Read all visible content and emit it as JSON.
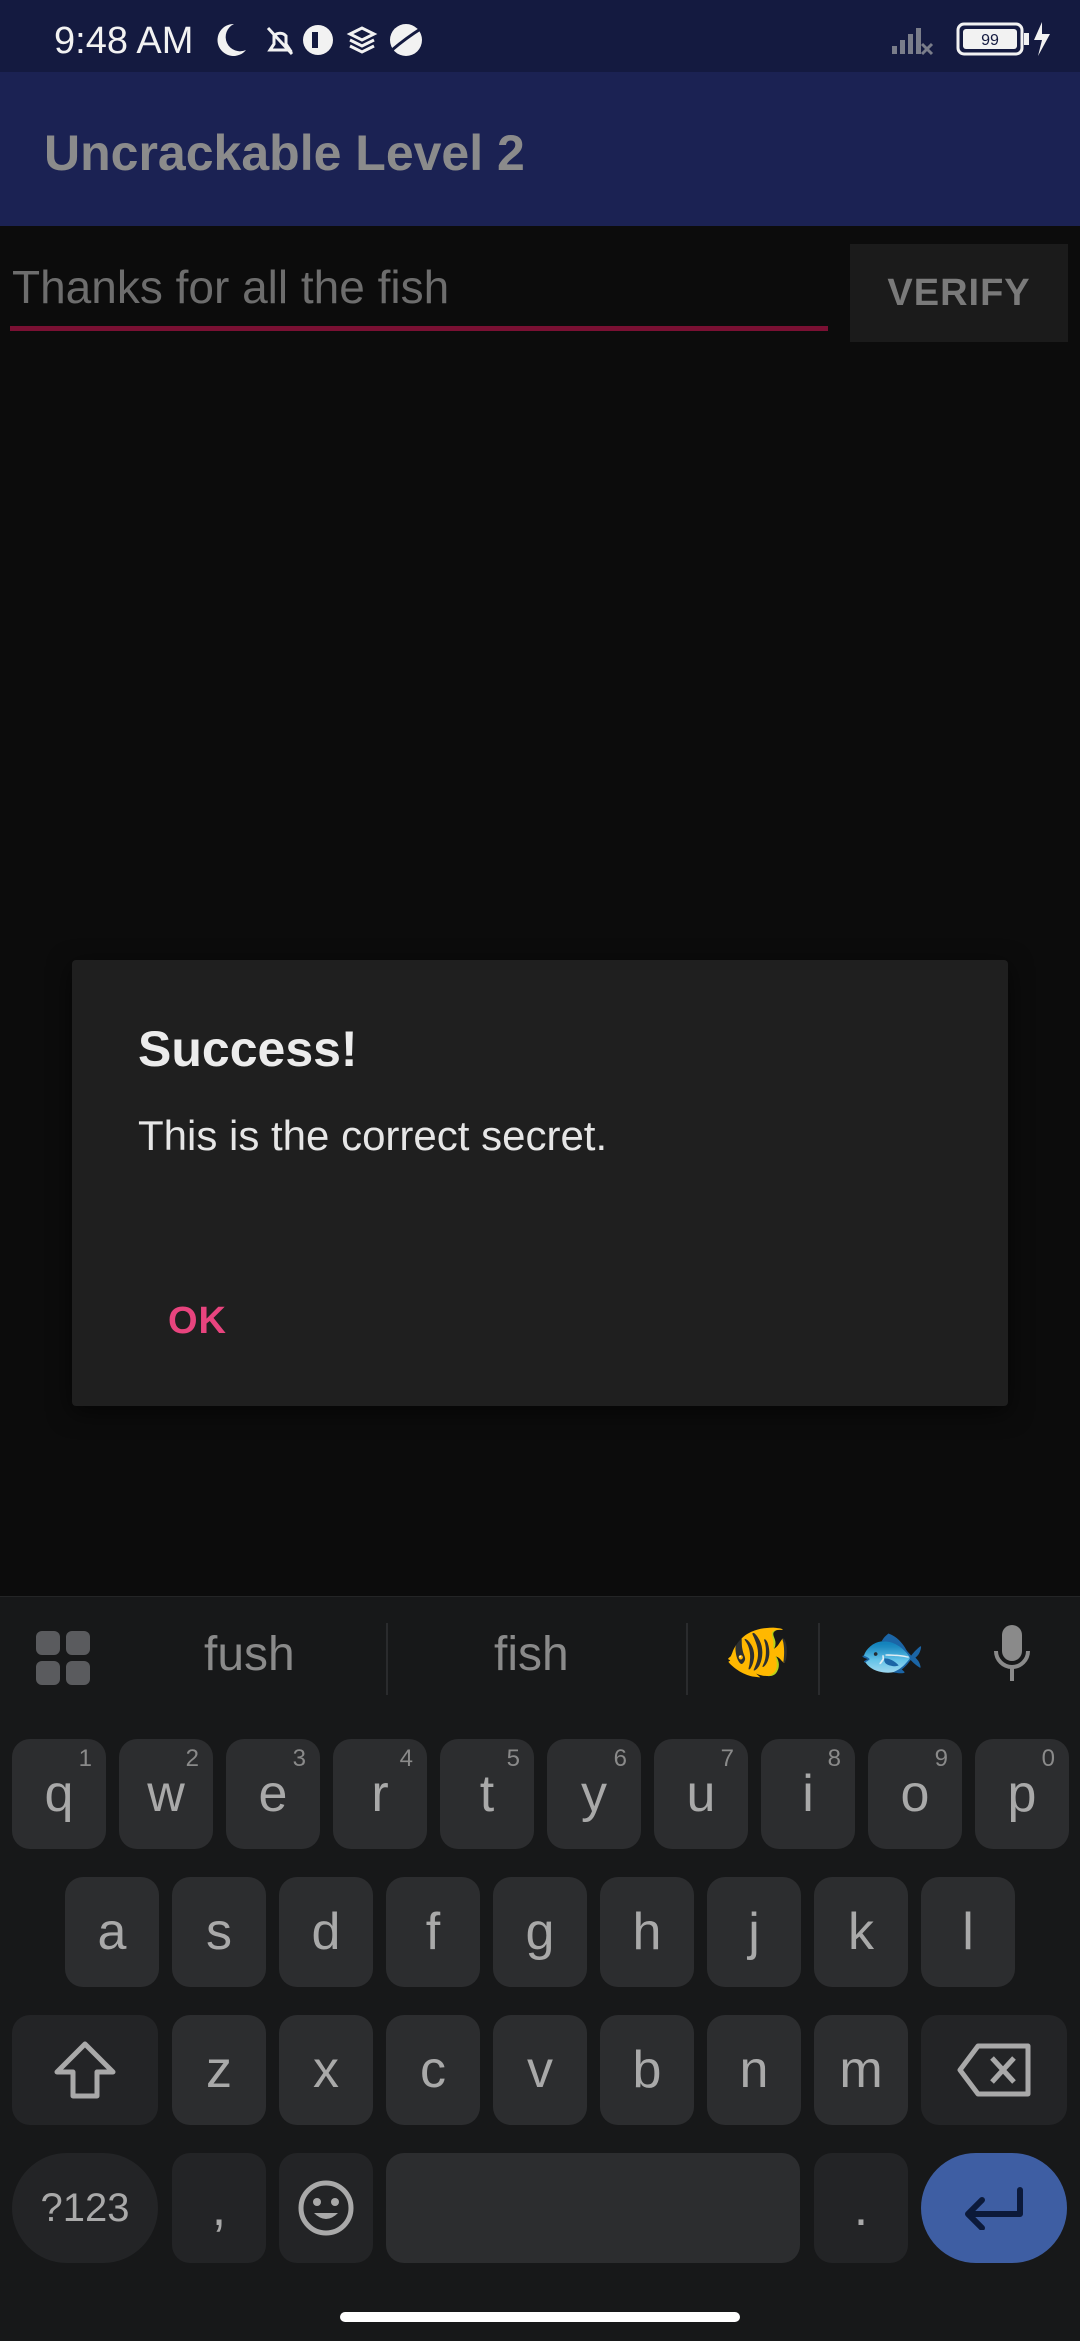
{
  "status": {
    "time": "9:48 AM",
    "battery": "99"
  },
  "app": {
    "title": "Uncrackable Level 2"
  },
  "form": {
    "input_value": "Thanks for all the fish",
    "verify_label": "VERIFY"
  },
  "dialog": {
    "title": "Success!",
    "message": "This is the correct secret.",
    "ok_label": "OK"
  },
  "keyboard": {
    "suggestions": [
      "fush",
      "fish"
    ],
    "emoji": [
      "🐠",
      "🐟"
    ],
    "row1": [
      {
        "k": "q",
        "h": "1"
      },
      {
        "k": "w",
        "h": "2"
      },
      {
        "k": "e",
        "h": "3"
      },
      {
        "k": "r",
        "h": "4"
      },
      {
        "k": "t",
        "h": "5"
      },
      {
        "k": "y",
        "h": "6"
      },
      {
        "k": "u",
        "h": "7"
      },
      {
        "k": "i",
        "h": "8"
      },
      {
        "k": "o",
        "h": "9"
      },
      {
        "k": "p",
        "h": "0"
      }
    ],
    "row2": [
      "a",
      "s",
      "d",
      "f",
      "g",
      "h",
      "j",
      "k",
      "l"
    ],
    "row3": [
      "z",
      "x",
      "c",
      "v",
      "b",
      "n",
      "m"
    ],
    "symbols_label": "?123",
    "comma_label": ",",
    "period_label": "."
  },
  "colors": {
    "accent_pink": "#e8447e",
    "appbar": "#1b2253",
    "enter_key": "#3e5ea3"
  }
}
